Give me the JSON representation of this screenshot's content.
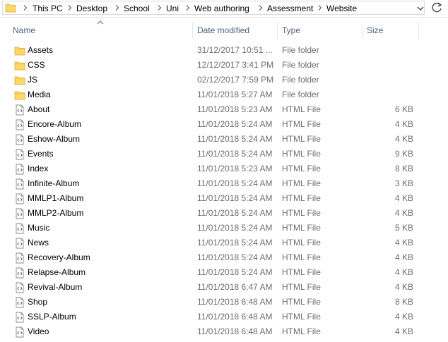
{
  "address": {
    "crumbs": [
      "This PC",
      "Desktop",
      "School",
      "Uni",
      "Web authoring",
      "Assessment",
      "Website"
    ]
  },
  "columns": {
    "name": "Name",
    "date_modified": "Date modified",
    "type": "Type",
    "size": "Size"
  },
  "files": [
    {
      "name": "Assets",
      "date": "31/12/2017 10:51 ...",
      "type": "File folder",
      "size": "",
      "kind": "folder"
    },
    {
      "name": "CSS",
      "date": "12/12/2017 3:41 PM",
      "type": "File folder",
      "size": "",
      "kind": "folder"
    },
    {
      "name": "JS",
      "date": "02/12/2017 7:59 PM",
      "type": "File folder",
      "size": "",
      "kind": "folder"
    },
    {
      "name": "Media",
      "date": "11/01/2018 5:27 AM",
      "type": "File folder",
      "size": "",
      "kind": "folder"
    },
    {
      "name": "About",
      "date": "11/01/2018 5:23 AM",
      "type": "HTML File",
      "size": "6 KB",
      "kind": "html"
    },
    {
      "name": "Encore-Album",
      "date": "11/01/2018 5:24 AM",
      "type": "HTML File",
      "size": "4 KB",
      "kind": "html"
    },
    {
      "name": "Eshow-Album",
      "date": "11/01/2018 5:24 AM",
      "type": "HTML File",
      "size": "4 KB",
      "kind": "html"
    },
    {
      "name": "Events",
      "date": "11/01/2018 5:24 AM",
      "type": "HTML File",
      "size": "9 KB",
      "kind": "html"
    },
    {
      "name": "Index",
      "date": "11/01/2018 5:23 AM",
      "type": "HTML File",
      "size": "8 KB",
      "kind": "html"
    },
    {
      "name": "Infinite-Album",
      "date": "11/01/2018 5:24 AM",
      "type": "HTML File",
      "size": "3 KB",
      "kind": "html"
    },
    {
      "name": "MMLP1-Album",
      "date": "11/01/2018 5:24 AM",
      "type": "HTML File",
      "size": "4 KB",
      "kind": "html"
    },
    {
      "name": "MMLP2-Album",
      "date": "11/01/2018 5:24 AM",
      "type": "HTML File",
      "size": "4 KB",
      "kind": "html"
    },
    {
      "name": "Music",
      "date": "11/01/2018 5:24 AM",
      "type": "HTML File",
      "size": "5 KB",
      "kind": "html"
    },
    {
      "name": "News",
      "date": "11/01/2018 5:24 AM",
      "type": "HTML File",
      "size": "4 KB",
      "kind": "html"
    },
    {
      "name": "Recovery-Album",
      "date": "11/01/2018 5:24 AM",
      "type": "HTML File",
      "size": "4 KB",
      "kind": "html"
    },
    {
      "name": "Relapse-Album",
      "date": "11/01/2018 5:24 AM",
      "type": "HTML File",
      "size": "4 KB",
      "kind": "html"
    },
    {
      "name": "Revival-Album",
      "date": "11/01/2018 6:47 AM",
      "type": "HTML File",
      "size": "4 KB",
      "kind": "html"
    },
    {
      "name": "Shop",
      "date": "11/01/2018 6:48 AM",
      "type": "HTML File",
      "size": "8 KB",
      "kind": "html"
    },
    {
      "name": "SSLP-Album",
      "date": "11/01/2018 6:48 AM",
      "type": "HTML File",
      "size": "4 KB",
      "kind": "html"
    },
    {
      "name": "Video",
      "date": "11/01/2018 6:48 AM",
      "type": "HTML File",
      "size": "4 KB",
      "kind": "html"
    }
  ],
  "colors": {
    "folder": "#ffd766",
    "header_text": "#4c607a",
    "detail_text": "#6d6d6d"
  }
}
